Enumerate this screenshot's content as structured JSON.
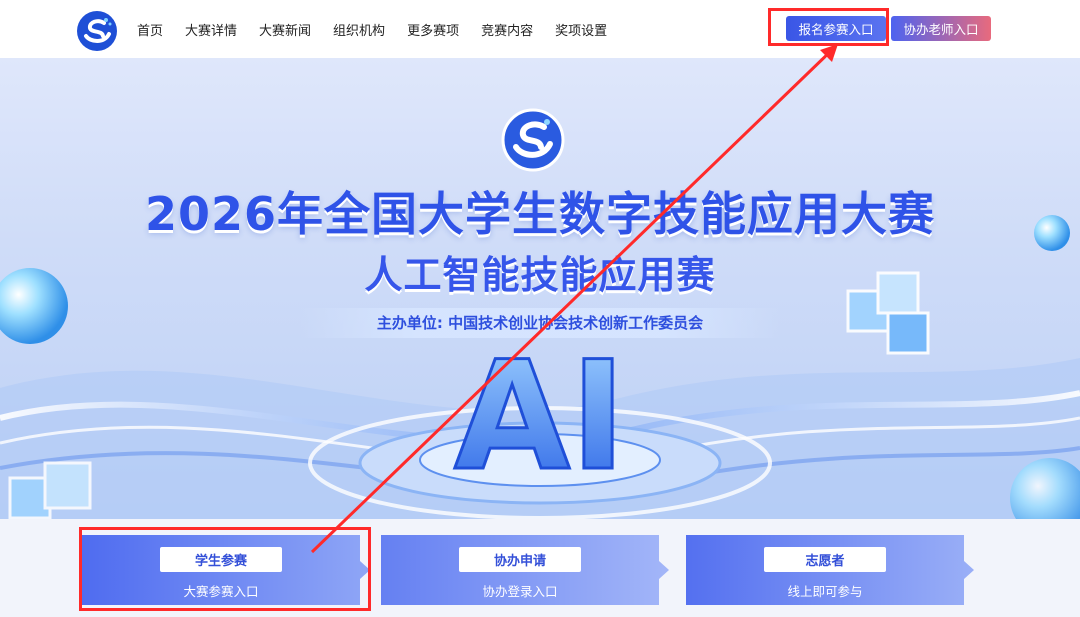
{
  "nav": {
    "logo_icon": "competition-logo-icon",
    "items": [
      "首页",
      "大赛详情",
      "大赛新闻",
      "组织机构",
      "更多赛项",
      "竞赛内容",
      "奖项设置"
    ],
    "register_button": "报名参赛入口",
    "teacher_button": "协办老师入口"
  },
  "hero": {
    "title": "2026年全国大学生数字技能应用大赛",
    "subtitle": "人工智能技能应用赛",
    "organizer": "主办单位: 中国技术创业协会技术创新工作委员会",
    "ai_text": "AI"
  },
  "cards": [
    {
      "label": "学生参赛",
      "sub": "大赛参赛入口"
    },
    {
      "label": "协办申请",
      "sub": "协办登录入口"
    },
    {
      "label": "志愿者",
      "sub": "线上即可参与"
    }
  ],
  "colors": {
    "primary": "#3a56e6",
    "highlight": "#ff2a2a",
    "card_start": "#4f6cf0",
    "card_end": "#8fa6f6"
  }
}
